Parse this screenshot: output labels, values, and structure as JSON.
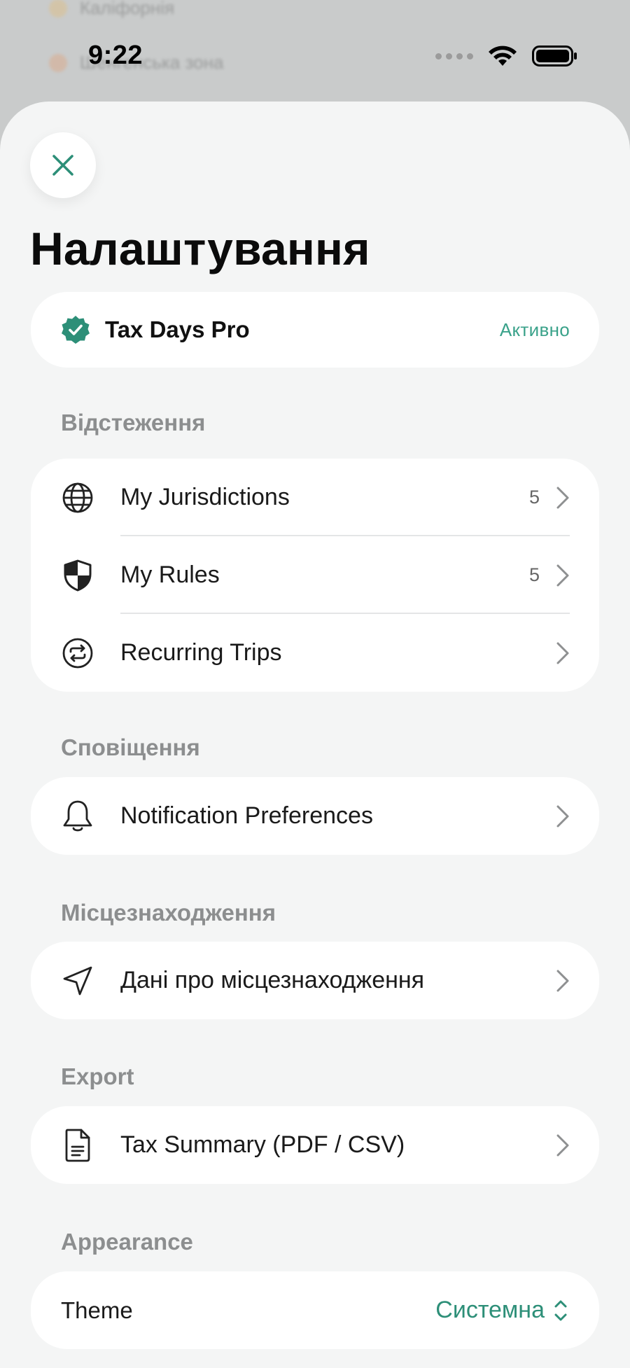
{
  "status_bar": {
    "time": "9:22"
  },
  "background": {
    "row1_text": "Каліфорнія",
    "row2_text": "Шенгенська зона"
  },
  "page": {
    "title": "Налаштування"
  },
  "pro": {
    "name": "Tax Days Pro",
    "status": "Активно"
  },
  "sections": {
    "tracking": {
      "title": "Відстеження",
      "items": [
        {
          "label": "My Jurisdictions",
          "count": "5",
          "icon": "globe-icon"
        },
        {
          "label": "My Rules",
          "count": "5",
          "icon": "shield-icon"
        },
        {
          "label": "Recurring Trips",
          "count": "",
          "icon": "repeat-icon"
        }
      ]
    },
    "notifications": {
      "title": "Сповіщення",
      "items": [
        {
          "label": "Notification Preferences",
          "icon": "bell-icon"
        }
      ]
    },
    "location": {
      "title": "Місцезнаходження",
      "items": [
        {
          "label": "Дані про місцезнаходження",
          "icon": "location-arrow-icon"
        }
      ]
    },
    "export": {
      "title": "Export",
      "items": [
        {
          "label": "Tax Summary (PDF / CSV)",
          "icon": "document-icon"
        }
      ]
    },
    "appearance": {
      "title": "Appearance",
      "theme_label": "Theme",
      "theme_value": "Системна"
    }
  },
  "colors": {
    "accent": "#2d8f78",
    "accent_light": "#3aa28a",
    "sheet_bg": "#f4f5f5",
    "card_bg": "#ffffff",
    "section_header": "#8c8e8f"
  }
}
